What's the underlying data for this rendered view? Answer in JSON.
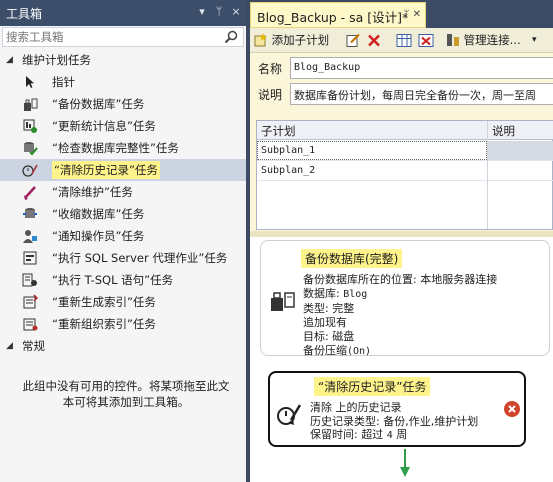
{
  "toolbox": {
    "title": "工具箱",
    "title_buttons": [
      "▾",
      "ᛘ",
      "×"
    ],
    "search": {
      "placeholder": "搜索工具箱"
    },
    "group1": "维护计划任务",
    "items": [
      {
        "label": "指针",
        "icon": "pointer-icon"
      },
      {
        "label": "“备份数据库”任务",
        "icon": "backup-database-icon"
      },
      {
        "label": "“更新统计信息”任务",
        "icon": "update-statistics-icon"
      },
      {
        "label": "“检查数据库完整性”任务",
        "icon": "check-integrity-icon"
      },
      {
        "label": "“清除历史记录”任务",
        "icon": "history-cleanup-icon",
        "selected": true
      },
      {
        "label": "“清除维护”任务",
        "icon": "maintenance-cleanup-icon"
      },
      {
        "label": "“收缩数据库”任务",
        "icon": "shrink-database-icon"
      },
      {
        "label": "“通知操作员”任务",
        "icon": "notify-operator-icon"
      },
      {
        "label": "“执行 SQL Server 代理作业”任务",
        "icon": "sql-agent-job-icon"
      },
      {
        "label": "“执行 T-SQL 语句”任务",
        "icon": "tsql-statement-icon"
      },
      {
        "label": "“重新生成索引”任务",
        "icon": "rebuild-index-icon"
      },
      {
        "label": "“重新组织索引”任务",
        "icon": "reorganize-index-icon"
      }
    ],
    "group2": "常规",
    "empty_line1": "此组中没有可用的控件。将某项拖至此文",
    "empty_line2": "本可将其添加到工具箱。"
  },
  "designer": {
    "tab_title": "Blog_Backup - sa [设计]*",
    "toolbar": {
      "add_subplan": "添加子计划",
      "manage_connections": "管理连接..."
    },
    "name_label": "名称",
    "name_value": "Blog_Backup",
    "desc_label": "说明",
    "desc_value": "数据库备份计划，每周日完全备份一次，周一至周",
    "grid": {
      "col_subplan": "子计划",
      "col_desc": "说明",
      "rows": [
        {
          "name": "Subplan_1",
          "desc": ""
        },
        {
          "name": "Subplan_2",
          "desc": ""
        }
      ]
    },
    "task_backup": {
      "title": "备份数据库(完整)",
      "line1": "备份数据库所在的位置: 本地服务器连接",
      "line2_label": "数据库: ",
      "line2_value": "Blog",
      "line3": "类型: 完整",
      "line4": "追加现有",
      "line5": "目标: 磁盘",
      "line6_label": "备份压缩",
      "line6_value": "(On)"
    },
    "task_cleanup": {
      "title": "“清除历史记录”任务",
      "line1": "清除  上的历史记录",
      "line2": "历史记录类型: 备份,作业,维护计划",
      "line3_label": "保留时间: 超过 ",
      "line3_value": "4",
      "line3_unit": " 周"
    }
  }
}
